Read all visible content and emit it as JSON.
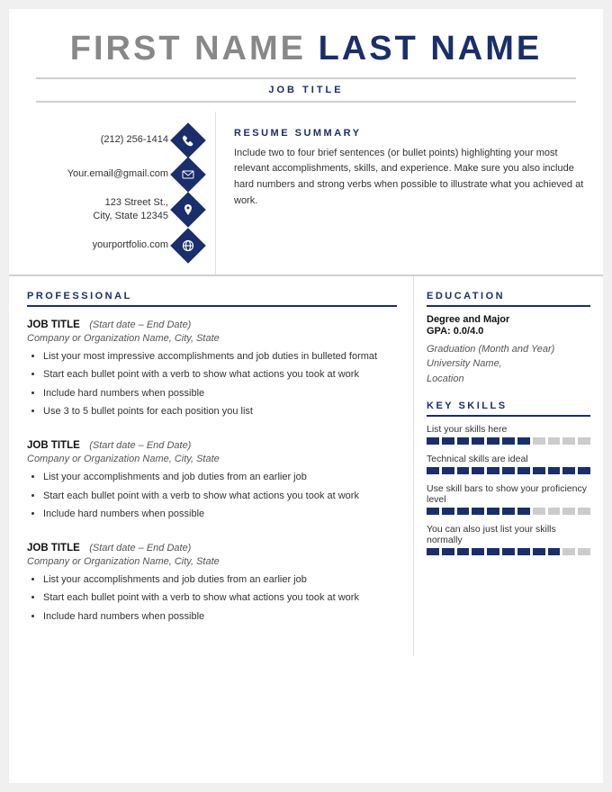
{
  "header": {
    "first_name": "FIRST NAME",
    "last_name": "LAST NAME",
    "job_title": "JOB TITLE"
  },
  "contact": {
    "phone": "(212) 256-1414",
    "email": "Your.email@gmail.com",
    "address_line1": "123 Street St.,",
    "address_line2": "City, State 12345",
    "portfolio": "yourportfolio.com"
  },
  "summary": {
    "title": "RESUME SUMMARY",
    "text": "Include two to four brief sentences (or bullet points) highlighting your most relevant accomplishments, skills, and experience. Make sure you also include hard numbers and strong verbs when possible to illustrate what you achieved at work."
  },
  "professional": {
    "section_title": "PROFESSIONAL",
    "jobs": [
      {
        "title": "JOB TITLE",
        "dates": "(Start date – End Date)",
        "company": "Company or Organization Name, City, State",
        "bullets": [
          "List your most impressive accomplishments and job duties in bulleted format",
          "Start each bullet point with a verb to show what actions you took at work",
          "Include hard numbers when possible",
          "Use 3 to 5 bullet points for each position you list"
        ]
      },
      {
        "title": "JOB TITLE",
        "dates": "(Start date – End Date)",
        "company": "Company or Organization Name, City, State",
        "bullets": [
          "List your accomplishments and job duties from an earlier job",
          "Start each bullet point with a verb to show what actions you took at work",
          "Include hard numbers when possible"
        ]
      },
      {
        "title": "JOB TITLE",
        "dates": "(Start date – End Date)",
        "company": "Company or Organization Name, City, State",
        "bullets": [
          "List your accomplishments and job duties from an earlier job",
          "Start each bullet point with a verb to show what actions you took at work",
          "Include hard numbers when possible"
        ]
      }
    ]
  },
  "education": {
    "section_title": "EDUCATION",
    "degree": "Degree and Major",
    "gpa": "GPA: 0.0/4.0",
    "graduation_label": "Graduation (Month and Year)",
    "university": "University Name,",
    "location": "Location"
  },
  "skills": {
    "section_title": "KEY SKILLS",
    "items": [
      {
        "label": "List your skills here",
        "filled": 7,
        "total": 11
      },
      {
        "label": "Technical skills are ideal",
        "filled": 11,
        "total": 11
      },
      {
        "label": "Use skill bars to show your proficiency level",
        "filled": 7,
        "total": 11
      },
      {
        "label": "You can also just list your skills normally",
        "filled": 9,
        "total": 11
      }
    ]
  }
}
